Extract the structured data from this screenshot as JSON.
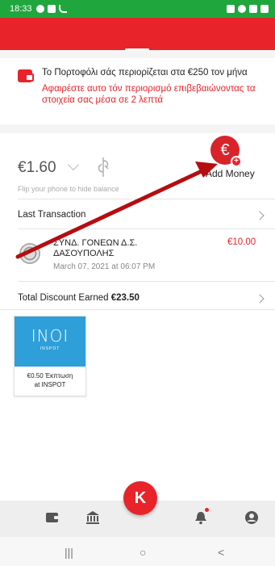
{
  "status_bar": {
    "time": "18:33",
    "color": "#1fa73e"
  },
  "colors": {
    "brand_red": "#e8232a",
    "status_green": "#1fa73e",
    "coupon_blue": "#2e9fd8"
  },
  "banner": {
    "icon": "wallet-icon",
    "title": "Το Πορτοφόλι σάς περιορίζεται στα €250 τον μήνα",
    "warning": "Αφαιρέστε αυτο τόν περιορισμό επιβεβαιώνοντας τα στοιχεία σας μέσα σε 2 λεπτά"
  },
  "balance": {
    "amount": "€1.60",
    "flip_hint": "Flip your phone to hide balance"
  },
  "add_money": {
    "symbol": "€",
    "label": "Add Money"
  },
  "last_transaction": {
    "label": "Last Transaction",
    "merchant_line1": "ΣΥΝΔ. ΓΟΝΕΩΝ Δ.Σ.",
    "merchant_line2": "ΔΑΣΟΥΠΟΛΗΣ",
    "date": "March 07, 2021 at 06:07 PM",
    "amount": "€10.00"
  },
  "discount": {
    "label": "Total Discount Earned",
    "value": "€23.50"
  },
  "coupon": {
    "logo_text": "INOI",
    "brand": "INSPOT",
    "line1": "€0.50 Έκπτωση",
    "line2": "at INSPOT"
  },
  "bottom_nav": {
    "items": [
      "wallet-icon",
      "bank-icon",
      "pay-icon",
      "bell-icon",
      "profile-icon"
    ],
    "center_symbol": "K"
  },
  "android_nav": {
    "recent": "|||",
    "home": "○",
    "back": "<"
  }
}
